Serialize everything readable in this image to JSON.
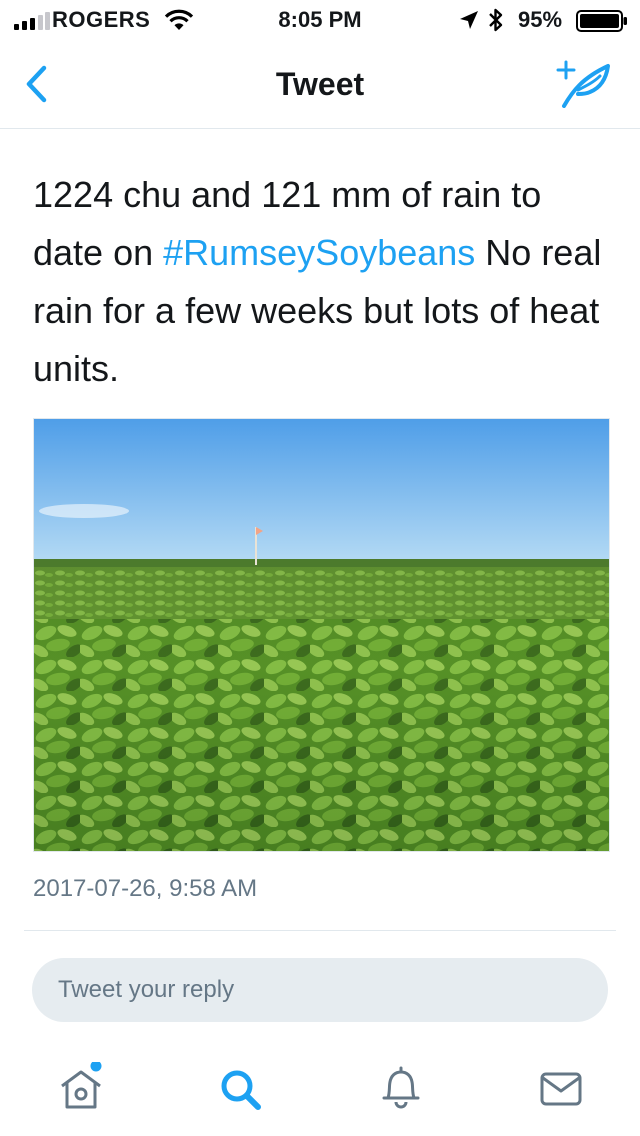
{
  "status_bar": {
    "carrier": "ROGERS",
    "time": "8:05 PM",
    "battery_percent": "95%",
    "signal_bars_filled": 3,
    "battery_level": 0.95
  },
  "nav": {
    "title": "Tweet",
    "back_icon": "chevron-left-icon",
    "compose_icon": "compose-tweet-icon"
  },
  "tweet": {
    "text_before": "1224 chu and 121 mm of rain to date on ",
    "hashtag": "#RumseySoybeans",
    "text_after": " No real rain for a few weeks but lots of heat units.",
    "timestamp": "2017-07-26, 9:58 AM"
  },
  "reply": {
    "placeholder": "Tweet your reply"
  },
  "tab_bar": {
    "items": [
      {
        "icon": "home-icon",
        "has_notification_dot": true
      },
      {
        "icon": "search-icon",
        "active": true
      },
      {
        "icon": "bell-icon"
      },
      {
        "icon": "mail-icon"
      }
    ]
  },
  "colors": {
    "accent": "#1da1f2",
    "text": "#14171a",
    "muted": "#657786",
    "reply_bg": "#e6ecf0"
  }
}
